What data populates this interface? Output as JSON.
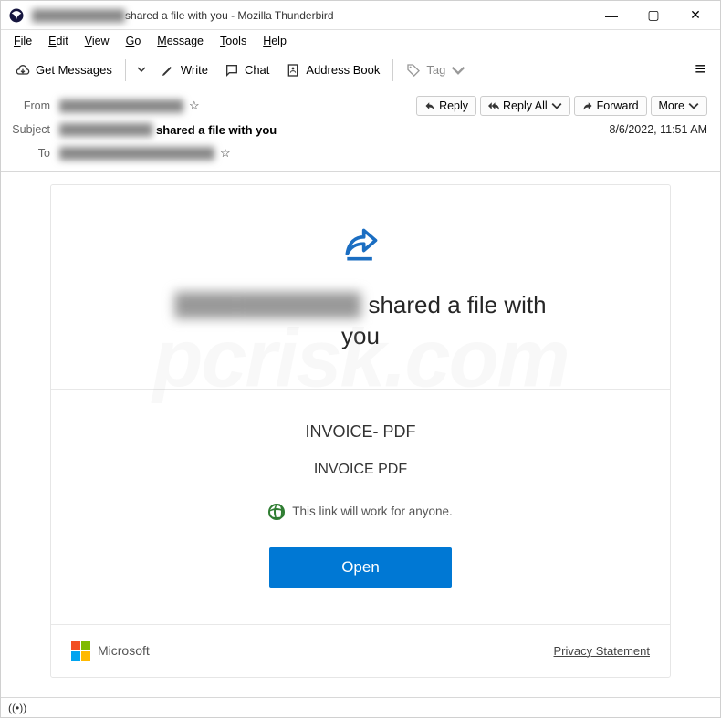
{
  "window": {
    "title_sender_redacted": "████████████",
    "title_suffix": " shared a file with you - Mozilla Thunderbird"
  },
  "menubar": [
    "File",
    "Edit",
    "View",
    "Go",
    "Message",
    "Tools",
    "Help"
  ],
  "toolbar": {
    "get_messages": "Get Messages",
    "write": "Write",
    "chat": "Chat",
    "address_book": "Address Book",
    "tag": "Tag"
  },
  "header": {
    "from_label": "From",
    "from_value_redacted": "████████████████",
    "subject_label": "Subject",
    "subject_prefix_redacted": "████████████",
    "subject_suffix": " shared a file with you",
    "to_label": "To",
    "to_value_redacted": "████████████████████",
    "date": "8/6/2022, 11:51 AM",
    "actions": {
      "reply": "Reply",
      "reply_all": "Reply All",
      "forward": "Forward",
      "more": "More"
    }
  },
  "body": {
    "headline_sender_redacted": "████████████",
    "headline_text": "shared a file with",
    "headline_text2": "you",
    "file_title": "INVOICE- PDF",
    "file_sub": "INVOICE PDF",
    "link_info": "This link will work for anyone.",
    "open_button": "Open",
    "footer_brand": "Microsoft",
    "privacy": "Privacy Statement"
  },
  "statusbar": {
    "icon_label": "((•))"
  }
}
